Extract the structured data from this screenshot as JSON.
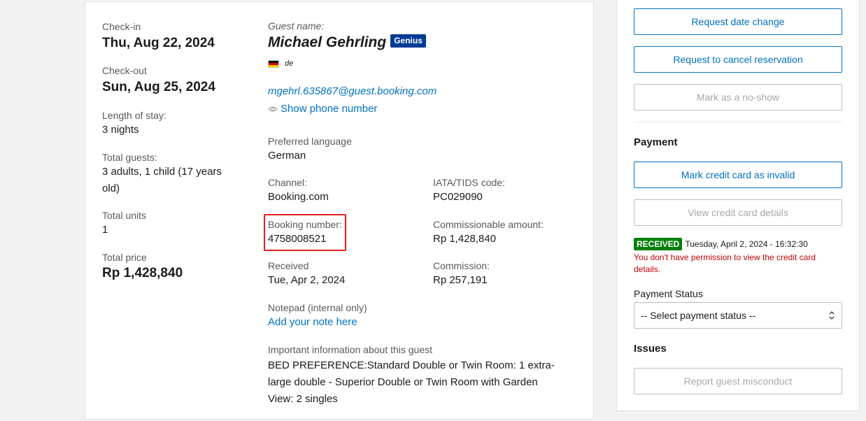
{
  "stay": {
    "checkin_label": "Check-in",
    "checkin_value": "Thu, Aug 22, 2024",
    "checkout_label": "Check-out",
    "checkout_value": "Sun, Aug 25, 2024",
    "length_label": "Length of stay:",
    "length_value": "3 nights",
    "guests_label": "Total guests:",
    "guests_value": "3 adults, 1 child (17 years old)",
    "units_label": "Total units",
    "units_value": "1",
    "price_label": "Total price",
    "price_value": "Rp 1,428,840"
  },
  "guest": {
    "name_label": "Guest name:",
    "name": "Michael Gehrling",
    "badge": "Genius",
    "language_code": "de",
    "flag_colors": [
      "#000000",
      "#dd0000",
      "#ffce00"
    ],
    "email": "mgehrl.635867@guest.booking.com",
    "phone_link": "Show phone number"
  },
  "details": {
    "preferred_language_label": "Preferred language",
    "preferred_language_value": "German",
    "channel_label": "Channel:",
    "channel_value": "Booking.com",
    "iata_label": "IATA/TIDS code:",
    "iata_value": "PC029090",
    "booking_number_label": "Booking number:",
    "booking_number_value": "4758008521",
    "commissionable_label": "Commissionable amount:",
    "commissionable_value": "Rp 1,428,840",
    "received_label": "Received",
    "received_value": "Tue, Apr 2, 2024",
    "commission_label": "Commission:",
    "commission_value": "Rp 257,191",
    "notepad_label": "Notepad (internal only)",
    "notepad_link": "Add your note here",
    "important_label": "Important information about this guest",
    "important_value": "BED PREFERENCE:Standard Double or Twin Room: 1 extra-large double - Superior Double or Twin Room with Garden View: 2 singles"
  },
  "actions": {
    "request_date_change": "Request date change",
    "request_cancel": "Request to cancel reservation",
    "mark_no_show": "Mark as a no-show"
  },
  "payment": {
    "title": "Payment",
    "mark_invalid": "Mark credit card as invalid",
    "view_details": "View credit card details",
    "received_badge": "RECEIVED",
    "received_date": "Tuesday, April 2, 2024 - 16:32:30",
    "permission_msg": "You don't have permission to view the credit card details.",
    "status_label": "Payment Status",
    "status_select": "-- Select payment status --"
  },
  "issues": {
    "title": "Issues",
    "report": "Report guest misconduct"
  },
  "colors": {
    "link": "#0071c2",
    "genius": "#003b95",
    "received": "#008009",
    "error": "#c00000",
    "highlight": "#e02020"
  }
}
